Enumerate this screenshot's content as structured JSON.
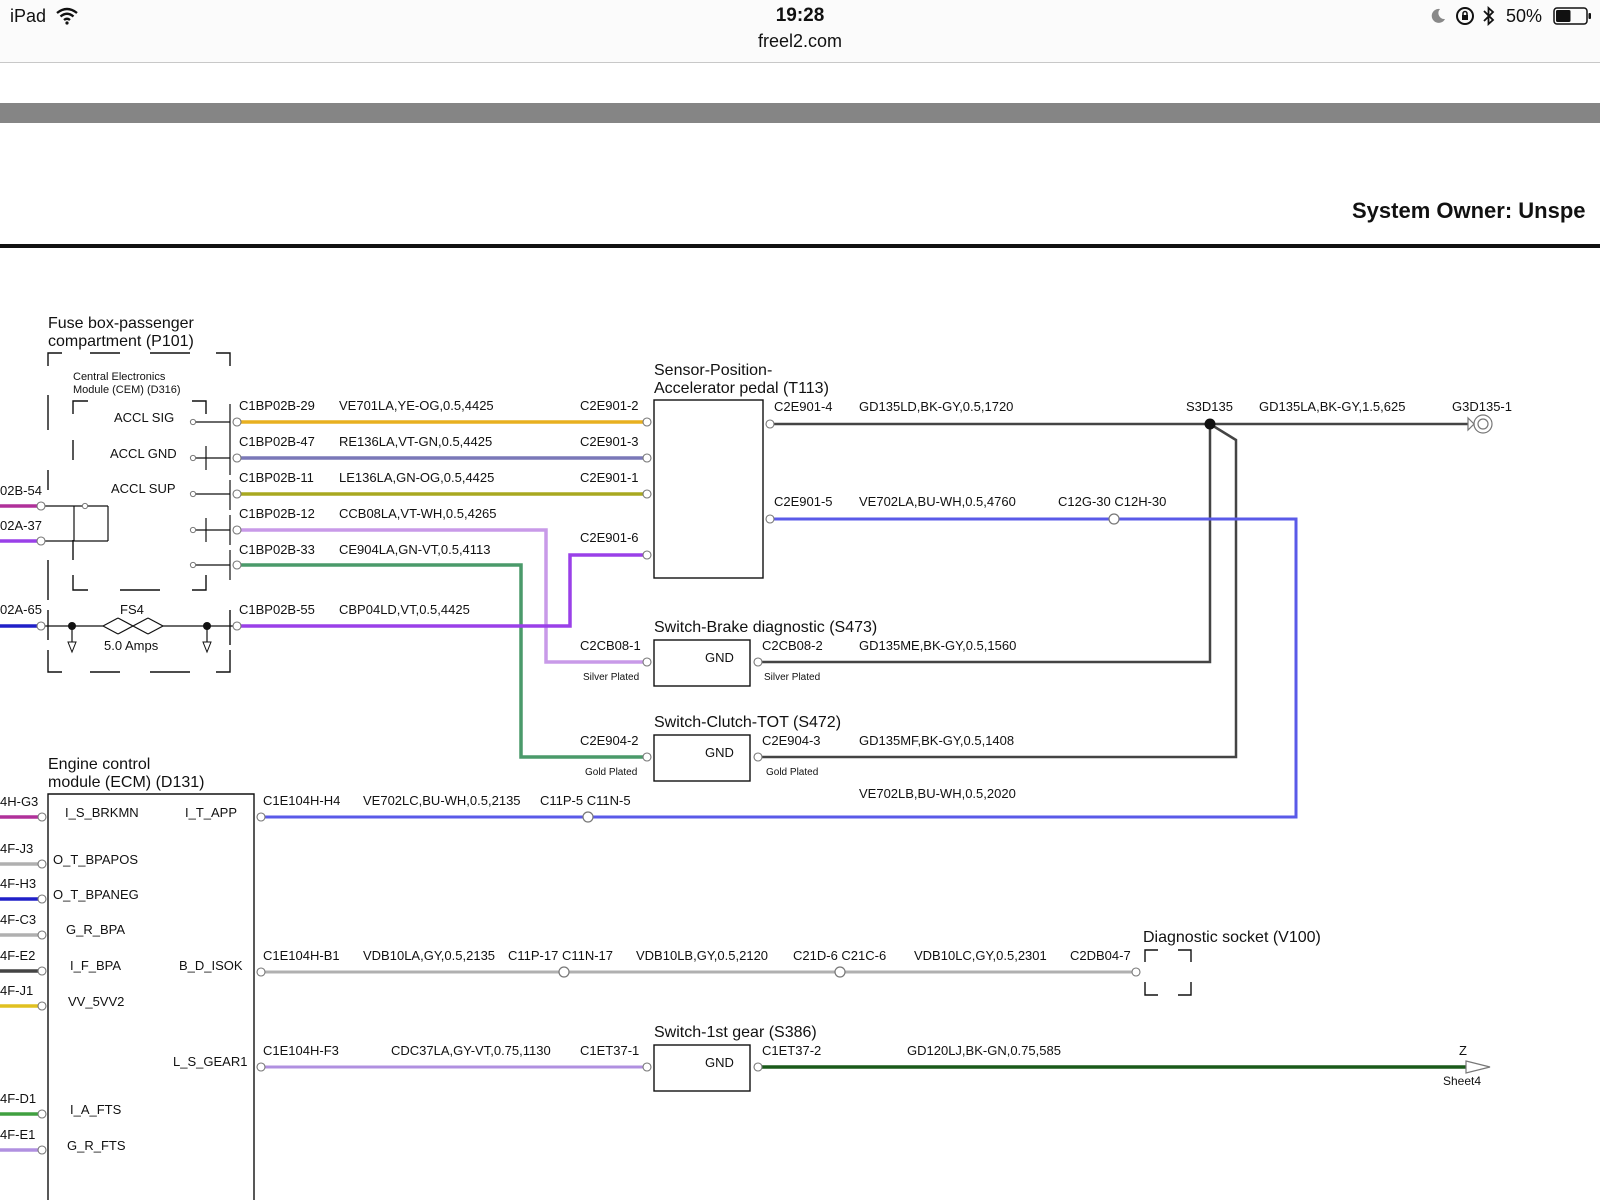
{
  "status_bar": {
    "device": "iPad",
    "time": "19:28",
    "url": "freel2.com",
    "battery": "50%",
    "icons": [
      "wifi-icon",
      "moon-icon",
      "rotation-lock-icon",
      "bluetooth-icon",
      "battery-icon"
    ]
  },
  "header": {
    "system_owner": "System Owner: Unspe"
  },
  "components": {
    "fuse_box_title_1": "Fuse box-passenger",
    "fuse_box_title_2": "compartment (P101)",
    "cem_title_1": "Central Electronics",
    "cem_title_2": "Module (CEM) (D316)",
    "accl_sig": "ACCL SIG",
    "accl_gnd": "ACCL GND",
    "accl_sup": "ACCL SUP",
    "fuse_name": "FS4",
    "fuse_rating": "5.0 Amps",
    "sensor_title_1": "Sensor-Position-",
    "sensor_title_2": "Accelerator pedal (T113)",
    "brake_title": "Switch-Brake diagnostic (S473)",
    "clutch_title": "Switch-Clutch-TOT (S472)",
    "gear_title": "Switch-1st gear (S386)",
    "gnd_label": "GND",
    "ecm_title_1": "Engine control",
    "ecm_title_2": "module (ECM) (D131)",
    "diag_title": "Diagnostic socket (V100)",
    "splice": "S3D135",
    "ground_point": "G3D135-1",
    "offpage_letter": "Z",
    "offpage_sheet": "Sheet4",
    "plating_silver": "Silver Plated",
    "plating_gold": "Gold Plated"
  },
  "ecm_pins": {
    "i_s_brkmn": "I_S_BRKMN",
    "i_t_app": "I_T_APP",
    "o_t_bpapos": "O_T_BPAPOS",
    "o_t_bpaneg": "O_T_BPANEG",
    "g_r_bpa": "G_R_BPA",
    "i_f_bpa": "I_F_BPA",
    "b_d_isok": "B_D_ISOK",
    "vv_5vv2": "VV_5VV2",
    "l_s_gear1": "L_S_GEAR1",
    "i_a_fts": "I_A_FTS",
    "g_r_fts": "G_R_FTS"
  },
  "edge_labels": {
    "p1": "02B-54",
    "p2": "02A-37",
    "p3": "02A-65",
    "e1": "4H-G3",
    "e2": "4F-J3",
    "e3": "4F-H3",
    "e4": "4F-C3",
    "e5": "4F-E2",
    "e6": "4F-J1",
    "e7": "4F-D1",
    "e8": "4F-E1"
  },
  "connectors": {
    "c1bp02b_29": "C1BP02B-29",
    "c1bp02b_47": "C1BP02B-47",
    "c1bp02b_11": "C1BP02B-11",
    "c1bp02b_12": "C1BP02B-12",
    "c1bp02b_33": "C1BP02B-33",
    "c1bp02b_55": "C1BP02B-55",
    "c2e901_2": "C2E901-2",
    "c2e901_3": "C2E901-3",
    "c2e901_1": "C2E901-1",
    "c2e901_6": "C2E901-6",
    "c2e901_4": "C2E901-4",
    "c2e901_5": "C2E901-5",
    "c12g_30": "C12G-30 C12H-30",
    "c2cb08_1": "C2CB08-1",
    "c2cb08_2": "C2CB08-2",
    "c2e904_2": "C2E904-2",
    "c2e904_3": "C2E904-3",
    "c1e104h_h4": "C1E104H-H4",
    "c11p_5": "C11P-5 C11N-5",
    "c1e104h_b1": "C1E104H-B1",
    "c11p_17": "C11P-17 C11N-17",
    "c21d_6": "C21D-6 C21C-6",
    "c2db04_7": "C2DB04-7",
    "c1e104h_f3": "C1E104H-F3",
    "c1et37_1": "C1ET37-1",
    "c1et37_2": "C1ET37-2"
  },
  "wires": {
    "w_ve701la": "VE701LA,YE-OG,0.5,4425",
    "w_re136la": "RE136LA,VT-GN,0.5,4425",
    "w_le136la": "LE136LA,GN-OG,0.5,4425",
    "w_ccb08la": "CCB08LA,VT-WH,0.5,4265",
    "w_ce904la": "CE904LA,GN-VT,0.5,4113",
    "w_cbp04ld": "CBP04LD,VT,0.5,4425",
    "w_gd135ld": "GD135LD,BK-GY,0.5,1720",
    "w_gd135la": "GD135LA,BK-GY,1.5,625",
    "w_ve702la": "VE702LA,BU-WH,0.5,4760",
    "w_gd135me": "GD135ME,BK-GY,0.5,1560",
    "w_gd135mf": "GD135MF,BK-GY,0.5,1408",
    "w_ve702lb": "VE702LB,BU-WH,0.5,2020",
    "w_ve702lc": "VE702LC,BU-WH,0.5,2135",
    "w_vdb10la": "VDB10LA,GY,0.5,2135",
    "w_vdb10lb": "VDB10LB,GY,0.5,2120",
    "w_vdb10lc": "VDB10LC,GY,0.5,2301",
    "w_cdc37la": "CDC37LA,GY-VT,0.75,1130",
    "w_gd120lj": "GD120LJ,BK-GN,0.75,585"
  },
  "wire_colors": {
    "ye_og": "#e8b020",
    "vt_gn": "#7a78b8",
    "gn_og": "#a8a820",
    "vt_wh": "#c89ae8",
    "gn_vt": "#4a9a6a",
    "vt": "#9a40e8",
    "bk_gy": "#444444",
    "bu_wh": "#5a5ae8",
    "gy": "#b0b0b0",
    "gy_vt": "#b090e0",
    "bk_gn": "#1a5a1a",
    "magenta": "#b0309a",
    "blue": "#2020c8",
    "green": "#40a040",
    "yellow": "#e0c020"
  }
}
